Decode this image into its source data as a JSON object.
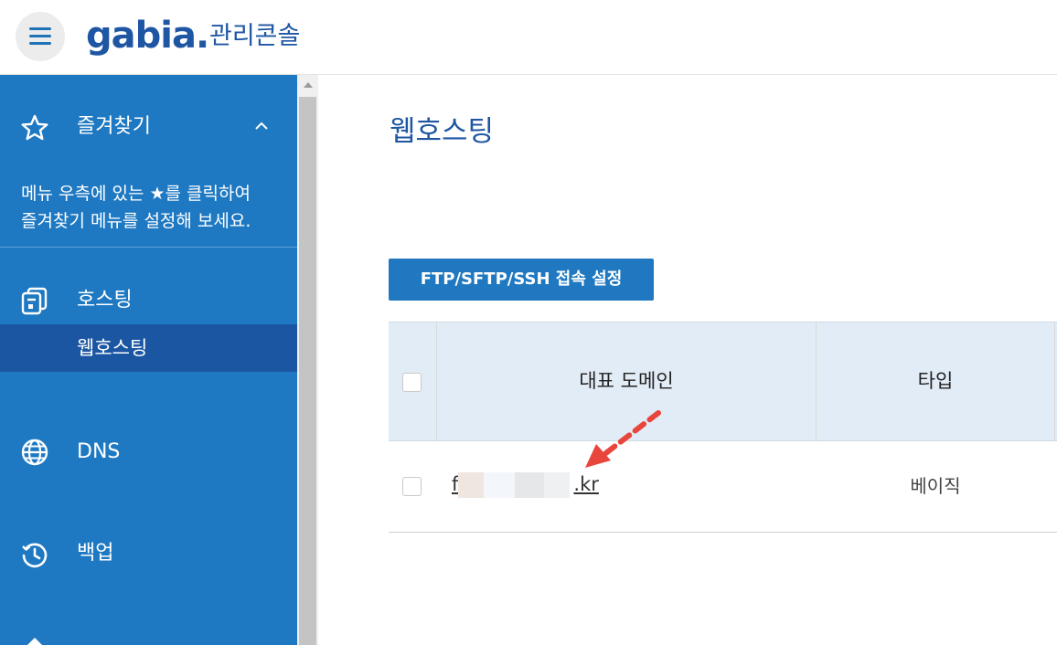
{
  "header": {
    "logo_text": "gabia.",
    "logo_sub": "관리콘솔"
  },
  "sidebar": {
    "favorites": {
      "label": "즐겨찾기",
      "description_line1": "메뉴 우측에 있는 ★를 클릭하여",
      "description_line2": "즐겨찾기 메뉴를 설정해 보세요."
    },
    "hosting": {
      "label": "호스팅",
      "sub_item": "웹호스팅"
    },
    "dns": {
      "label": "DNS"
    },
    "backup": {
      "label": "백업"
    }
  },
  "main": {
    "page_title": "웹호스팅",
    "ftp_button": "FTP/SFTP/SSH 접속 설정",
    "table": {
      "columns": [
        "대표 도메인",
        "타입"
      ],
      "rows": [
        {
          "domain_prefix": "f",
          "domain_suffix": ".kr",
          "type": "베이직"
        }
      ]
    }
  },
  "colors": {
    "brand_blue": "#1f56a3",
    "sidebar_blue": "#1f79c2",
    "sidebar_active": "#1b56a2",
    "button_blue": "#1f78c0",
    "table_header_bg": "#e2ecf7",
    "annotation_arrow": "#e8453c"
  },
  "icons": {
    "menu": "hamburger-icon",
    "favorites": "star-icon",
    "favorites_toggle": "chevron-up-icon",
    "hosting": "hosting-icon",
    "dns": "globe-icon",
    "backup": "history-icon"
  }
}
